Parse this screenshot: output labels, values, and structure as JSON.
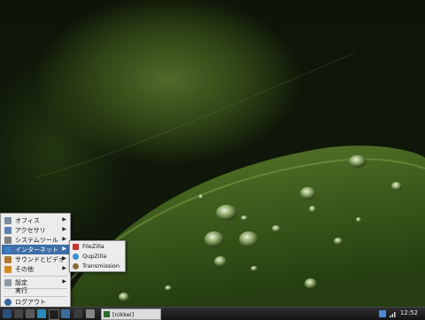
{
  "menu": {
    "items": [
      {
        "label": "オフィス",
        "color": "#7a8ca0"
      },
      {
        "label": "アクセサリ",
        "color": "#5a7fb0"
      },
      {
        "label": "システムツール",
        "color": "#7d7d7d"
      },
      {
        "label": "インターネット",
        "color": "#3f7fc4"
      },
      {
        "label": "サウンドとビデオ",
        "color": "#b07a30"
      },
      {
        "label": "その他",
        "color": "#d08a20"
      }
    ],
    "settings_label": "設定",
    "run_label": "実行",
    "logout_label": "ログアウト"
  },
  "submenu": {
    "items": [
      {
        "label": "FileZilla",
        "color": "#c8322a"
      },
      {
        "label": "QupZilla",
        "color": "#3a8ad0"
      },
      {
        "label": "Transmission",
        "color": "#8a6a3a"
      }
    ]
  },
  "taskbar": {
    "task_label": "[nikkei]",
    "clock": "12:52"
  }
}
